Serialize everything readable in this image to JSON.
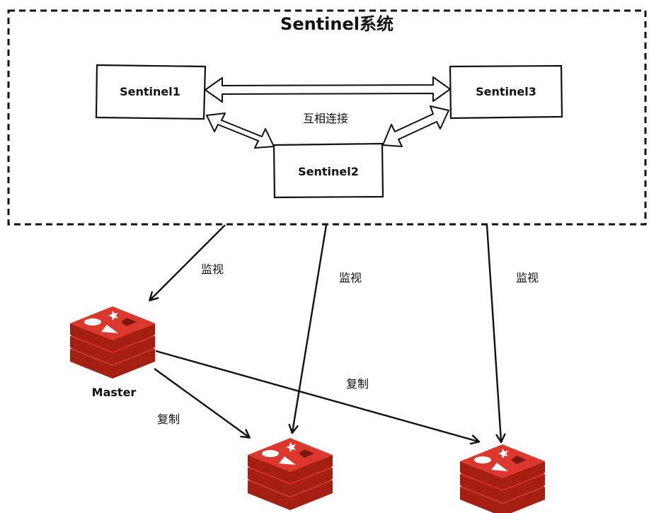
{
  "system": {
    "title": "Sentinel系统"
  },
  "sentinels": [
    {
      "label": "Sentinel1"
    },
    {
      "label": "Sentinel2"
    },
    {
      "label": "Sentinel3"
    }
  ],
  "edges": {
    "interconnect_label": "互相连接",
    "monitor_label": "监视",
    "replicate_label": "复制"
  },
  "nodes": {
    "master_label": "Master"
  },
  "colors": {
    "redis_top": "#dc382d",
    "redis_side": "#a41e11",
    "redis_mid": "#c6302b",
    "stroke": "#111111"
  }
}
